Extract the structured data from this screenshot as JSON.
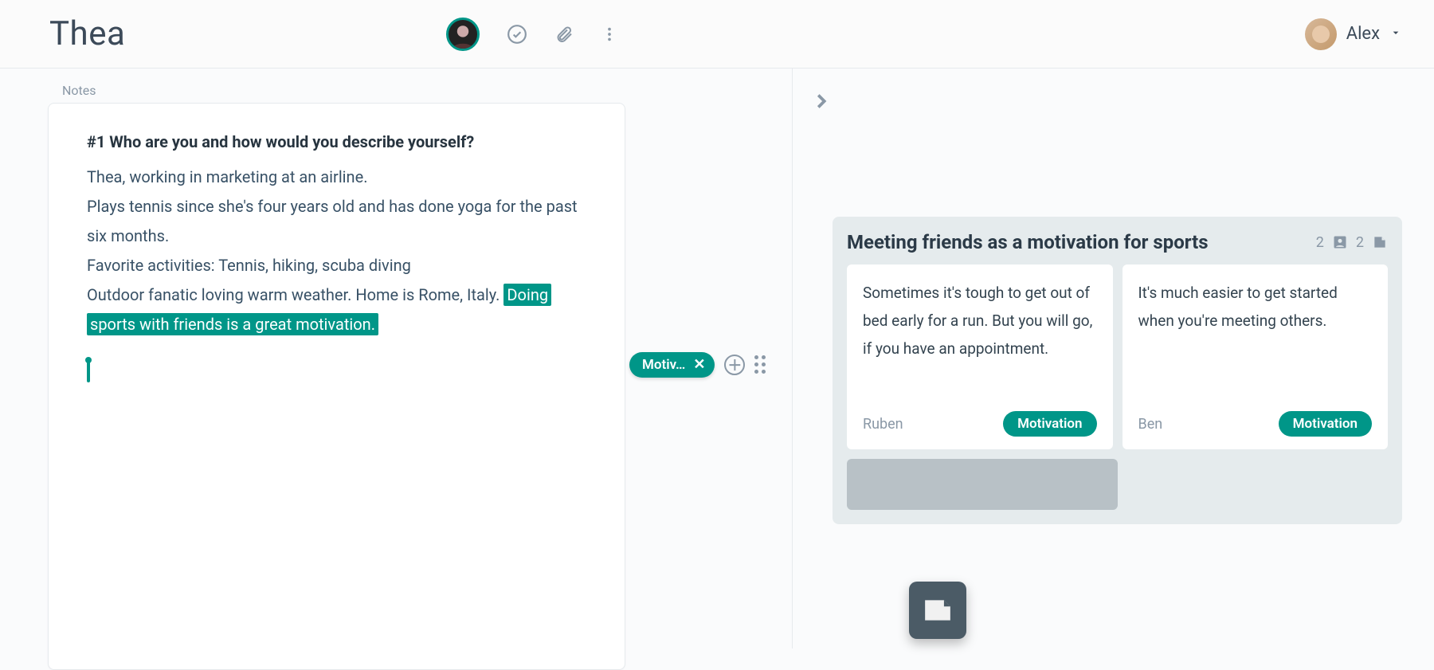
{
  "header": {
    "title": "Thea",
    "user_name": "Alex"
  },
  "notes": {
    "label": "Notes",
    "heading": "#1 Who are you and how would you describe yourself?",
    "line1": "Thea, working in marketing at an airline.",
    "line2": "Plays tennis since she's four years old and has done yoga for the past six months.",
    "line3": "Favorite activities: Tennis, hiking, scuba diving",
    "line4_pre": "Outdoor fanatic loving warm weather. Home is Rome, Italy. ",
    "hl_a": "Doing",
    "hl_b": "sports with friends is a great motivation."
  },
  "tag_pill": {
    "label": "Motiv…"
  },
  "cluster": {
    "title": "Meeting friends as a motivation for sports",
    "count_people": "2",
    "count_docs": "2",
    "cards": [
      {
        "text": "Sometimes it's tough to get out of bed early for a run. But you will go, if you have an appointment.",
        "author": "Ruben",
        "tag": "Motivation"
      },
      {
        "text": "It's much easier to get started when you're meeting others.",
        "author": "Ben",
        "tag": "Motivation"
      }
    ]
  },
  "colors": {
    "teal": "#009688"
  }
}
